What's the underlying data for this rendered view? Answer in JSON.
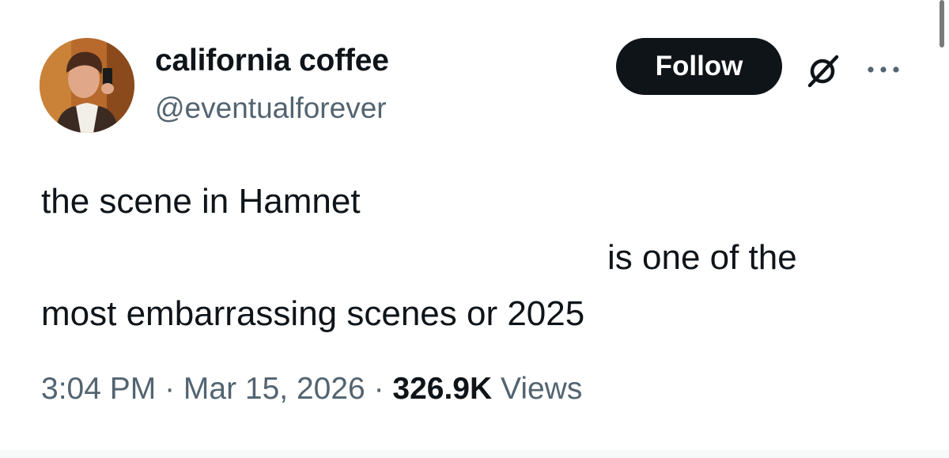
{
  "author": {
    "display_name": "california coffee",
    "handle": "@eventualforever",
    "avatar_icon": "profile-photo"
  },
  "actions": {
    "follow_label": "Follow",
    "grok_icon": "grok-slash-circle-icon",
    "more_icon": "more-horizontal-icon"
  },
  "tweet": {
    "line_1": "the scene in Hamnet",
    "line_2": "is one of the",
    "line_3": "most embarrassing scenes or 2025"
  },
  "meta": {
    "time": "3:04 PM",
    "separator_1": " · ",
    "date": "Mar 15, 2026",
    "separator_2": " · ",
    "views_count": "326.9K",
    "views_label": " Views"
  },
  "colors": {
    "text_primary": "#0f1419",
    "text_secondary": "#536471",
    "follow_bg": "#0f1419",
    "follow_text": "#ffffff"
  }
}
